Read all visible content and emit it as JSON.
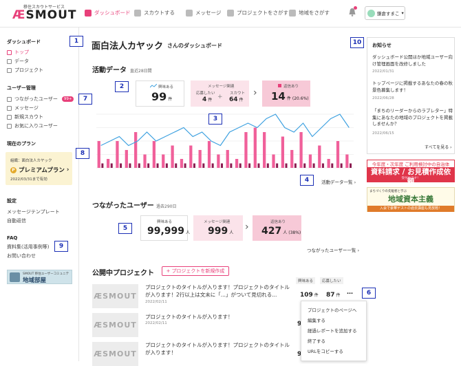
{
  "header": {
    "logo_sub": "移住スカウトサービス",
    "logo_ae": "Æ",
    "logo_text": "SMOUT",
    "nav": [
      {
        "label": "ダッシュボード",
        "active": true
      },
      {
        "label": "スカウトする"
      },
      {
        "label": "メッセージ"
      },
      {
        "label": "プロジェクトをさがす"
      },
      {
        "label": "地域をさがす"
      }
    ],
    "user_name": "鎌倉すまこ",
    "user_caret": "▾"
  },
  "sidebar": {
    "sections": [
      {
        "title": "ダッシュボード",
        "items": [
          {
            "label": "トップ",
            "active": true
          },
          {
            "label": "データ"
          },
          {
            "label": "プロジェクト"
          }
        ]
      },
      {
        "title": "ユーザー管理",
        "items": [
          {
            "label": "つながったユーザー",
            "badge": "99+"
          },
          {
            "label": "メッセージ"
          },
          {
            "label": "新規スカウト"
          },
          {
            "label": "お気に入りユーザー"
          }
        ]
      }
    ],
    "plan_title": "現在のプラン",
    "plan_org": "組織：面白法人カヤック",
    "plan_coin": "P",
    "plan_name": "プレミアムプラン",
    "plan_chevron": "›",
    "plan_until": "2022/03/31まで有効",
    "settings_title": "設定",
    "settings_items": [
      "メッセージテンプレート",
      "自動返信"
    ],
    "faq_title": "FAQ",
    "faq_items": [
      "資料集(活用事例等)",
      "お問い合わせ"
    ],
    "banner_small": "SMOUT 移住ユーザーコミュニティ",
    "banner_big": "地域部屋"
  },
  "markers": [
    "1",
    "2",
    "3",
    "4",
    "5",
    "6",
    "7",
    "8",
    "9",
    "10"
  ],
  "dashboard": {
    "org_name": "面白法人カヤック",
    "title_suffix": "さんのダッシュボード",
    "activity_title": "活動データ",
    "activity_period": "直近28日間",
    "interested_label": "興味ある",
    "interested_value": "99",
    "interested_unit": "件",
    "message_label": "メッセージ関連",
    "apply_label": "応募したい",
    "apply_value": "4",
    "apply_unit": "件",
    "plus": "+",
    "scout_label": "スカウト",
    "scout_value": "64",
    "scout_unit": "件",
    "reply_label": "返信あり",
    "reply_value": "14",
    "reply_unit": "件",
    "reply_pct": "(20.6%)",
    "activity_link": "活動データ一覧",
    "link_chevron": "›",
    "arrow": "›",
    "connected_title": "つながったユーザー",
    "connected_period": "過去290日",
    "c_interested_label": "興味ある",
    "c_interested_value": "99,999",
    "c_interested_unit": "人",
    "c_message_label": "メッセージ関連",
    "c_message_value": "999",
    "c_message_unit": "人",
    "c_reply_label": "返信あり",
    "c_reply_value": "427",
    "c_reply_unit": "人",
    "c_reply_pct": "(38%)",
    "connected_link": "つながったユーザー一覧"
  },
  "projects": {
    "title": "公開中プロジェクト",
    "new_button_plus": "+",
    "new_button": "プロジェクトを新規作成",
    "col_interested": "興味ある",
    "col_apply": "応募したい",
    "thumb_text": "ÆSMOUT",
    "more": "…",
    "items": [
      {
        "title": "プロジェクトのタイトルが入ります！プロジェクトのタイトルが入ります！2行以上は文末に「...」がついて見切れる...",
        "date": "2022/02/11",
        "interested": "109",
        "apply": "87",
        "interested_unit": "件",
        "apply_unit": "件"
      },
      {
        "title": "プロジェクトのタイトルが入ります！",
        "date": "2022/02/11",
        "interested": "9",
        "apply": ""
      },
      {
        "title": "プロジェクトのタイトルが入ります！プロジェクトのタイトルが入ります！",
        "date": "",
        "interested": "9",
        "apply": ""
      }
    ],
    "menu": [
      "プロジェクトのページへ",
      "編集する",
      "経過レポートを追加する",
      "終了する",
      "URLをコピーする"
    ]
  },
  "news": {
    "title": "お知らせ",
    "items": [
      {
        "text": "ダッシュボード公開ほか地域ユーザー向け管理画面を改修しました",
        "date": "2022/01/31"
      },
      {
        "text": "トップページに掲載するあなたの春の秋景色募集します！",
        "date": "2022/06/28"
      },
      {
        "text": "「まちのリーダーからのラブレター」特集にあなたの地域のプロジェクトを掲載しませんか？",
        "date": "2022/06/15"
      }
    ],
    "more": "すべてを見る",
    "more_chevron": "›"
  },
  "ads": {
    "ad1_top": "今年度・次年度 ご利用検討中の自治体",
    "ad1_main": "資料請求 / お見積作成依頼",
    "ad1_sub": "受付中です！",
    "ad2_top": "まちづくりの先駆者と学ぶ",
    "ad2_main": "地域資本主義",
    "ad2_bottom": "入会で豪華ゲストの過去講座も見放題！"
  },
  "chart_data": {
    "type": "bar",
    "categories": [
      "1",
      "2",
      "3",
      "4",
      "5",
      "6",
      "7",
      "8",
      "9",
      "10",
      "11",
      "12",
      "13",
      "14",
      "15",
      "16",
      "17",
      "18",
      "19",
      "20",
      "21",
      "22",
      "23",
      "24",
      "25",
      "26",
      "27",
      "28"
    ],
    "x_tick_labels": [
      "",
      "",
      "",
      "",
      "",
      "",
      "",
      "",
      "",
      "",
      "",
      "",
      "",
      ""
    ],
    "series": [
      {
        "kind": "bar",
        "values": [
          6,
          2,
          6,
          4,
          8,
          3,
          6,
          3,
          5,
          2,
          5,
          4,
          6,
          3,
          4,
          2,
          8,
          9,
          8,
          3,
          7,
          4,
          8,
          3,
          5,
          2,
          6,
          3
        ]
      },
      {
        "kind": "bar",
        "values": [
          1,
          1,
          1,
          1,
          1,
          1,
          1,
          1,
          1,
          1,
          1,
          1,
          1,
          1,
          1,
          1,
          1,
          1,
          1,
          1,
          1,
          1,
          1,
          1,
          1,
          1,
          1,
          1
        ]
      },
      {
        "kind": "line",
        "values": [
          5,
          6,
          7,
          5,
          6,
          8,
          6,
          7,
          8,
          9,
          7,
          8,
          6,
          5,
          8,
          9,
          10,
          9,
          11,
          12,
          9,
          8,
          10,
          7,
          9,
          11,
          12,
          9
        ]
      }
    ],
    "ylim": [
      0,
      12
    ],
    "grid": true,
    "colors": {
      "bar": "#f0609a",
      "bar2": "#8a1a4f",
      "line": "#3ea1e0"
    }
  }
}
